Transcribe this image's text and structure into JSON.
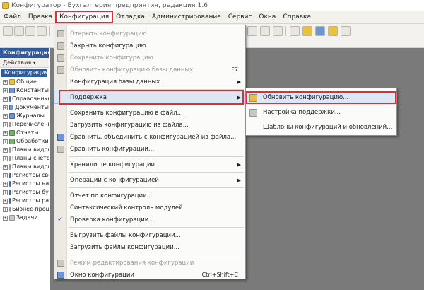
{
  "window": {
    "title": "Конфигуратор - Бухгалтерия предприятия, редакция 1.6"
  },
  "menubar": {
    "items": [
      {
        "label": "Файл",
        "active": false
      },
      {
        "label": "Правка",
        "active": false
      },
      {
        "label": "Конфигурация",
        "active": true
      },
      {
        "label": "Отладка",
        "active": false
      },
      {
        "label": "Администрирование",
        "active": false
      },
      {
        "label": "Сервис",
        "active": false
      },
      {
        "label": "Окна",
        "active": false
      },
      {
        "label": "Справка",
        "active": false
      }
    ]
  },
  "left_panel": {
    "header": "Конфигурация",
    "actions": "Действия ▾",
    "tree": [
      {
        "label": "Конфигурация",
        "root": true
      },
      {
        "label": "Общие",
        "icon": "folder"
      },
      {
        "label": "Константы",
        "icon": "blue"
      },
      {
        "label": "Справочники",
        "icon": "blue"
      },
      {
        "label": "Документы",
        "icon": "blue"
      },
      {
        "label": "Журналы",
        "icon": "blue"
      },
      {
        "label": "Перечисления",
        "icon": "grey"
      },
      {
        "label": "Отчеты",
        "icon": "green"
      },
      {
        "label": "Обработки",
        "icon": "green"
      },
      {
        "label": "Планы видов",
        "icon": "grey"
      },
      {
        "label": "Планы счетов",
        "icon": "grey"
      },
      {
        "label": "Планы видов",
        "icon": "grey"
      },
      {
        "label": "Регистры сведений",
        "icon": "blue"
      },
      {
        "label": "Регистры накопления",
        "icon": "blue"
      },
      {
        "label": "Регистры бухгалтерии",
        "icon": "blue"
      },
      {
        "label": "Регистры расчета",
        "icon": "blue"
      },
      {
        "label": "Бизнес-процессы",
        "icon": "grey"
      },
      {
        "label": "Задачи",
        "icon": "grey"
      }
    ]
  },
  "dropdown": {
    "items": [
      {
        "type": "item",
        "label": "Открыть конфигурацию",
        "disabled": true,
        "icon": "grey"
      },
      {
        "type": "item",
        "label": "Закрыть конфигурацию",
        "icon": "grey"
      },
      {
        "type": "item",
        "label": "Сохранить конфигурацию",
        "disabled": true,
        "icon": "grey"
      },
      {
        "type": "item",
        "label": "Обновить конфигурацию базы данных",
        "disabled": true,
        "icon": "grey",
        "shortcut": "F7"
      },
      {
        "type": "item",
        "label": "Конфигурация базы данных",
        "submenu": true
      },
      {
        "type": "sep"
      },
      {
        "type": "item",
        "label": "Поддержка",
        "submenu": true,
        "highlighted": true
      },
      {
        "type": "sep"
      },
      {
        "type": "item",
        "label": "Сохранить конфигурацию в файл..."
      },
      {
        "type": "item",
        "label": "Загрузить конфигурацию из файла..."
      },
      {
        "type": "item",
        "label": "Сравнить, объединить с конфигурацией из файла...",
        "icon": "blue"
      },
      {
        "type": "item",
        "label": "Сравнить конфигурации...",
        "icon": "grey"
      },
      {
        "type": "sep"
      },
      {
        "type": "item",
        "label": "Хранилище конфигурации",
        "submenu": true
      },
      {
        "type": "sep"
      },
      {
        "type": "item",
        "label": "Операции с конфигурацией",
        "submenu": true
      },
      {
        "type": "sep"
      },
      {
        "type": "item",
        "label": "Отчет по конфигурации..."
      },
      {
        "type": "item",
        "label": "Синтаксический контроль модулей"
      },
      {
        "type": "item",
        "label": "Проверка конфигурации...",
        "icon": "check"
      },
      {
        "type": "sep"
      },
      {
        "type": "item",
        "label": "Выгрузить файлы конфигурации..."
      },
      {
        "type": "item",
        "label": "Загрузить файлы конфигурации..."
      },
      {
        "type": "sep"
      },
      {
        "type": "item",
        "label": "Режим редактирования конфигурации",
        "disabled": true,
        "icon": "grey"
      },
      {
        "type": "item",
        "label": "Окно конфигурации",
        "icon": "blue",
        "shortcut": "Ctrl+Shift+C"
      }
    ]
  },
  "submenu": {
    "items": [
      {
        "label": "Обновить конфигурацию...",
        "highlighted": true,
        "icon": "folder"
      },
      {
        "label": "Настройка поддержки...",
        "icon": "grey"
      },
      {
        "label": "Шаблоны конфигураций и обновлений..."
      }
    ]
  }
}
